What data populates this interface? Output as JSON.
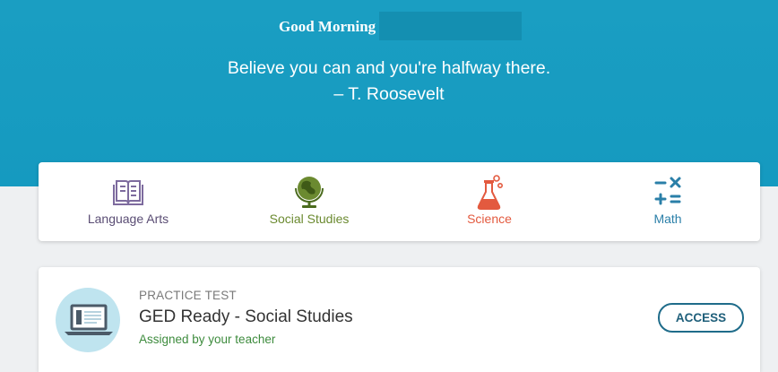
{
  "hero": {
    "greeting": "Good Morning",
    "quote_text": "Believe you can and you're halfway there.",
    "quote_author": "– T. Roosevelt"
  },
  "subjects": [
    {
      "label": "Language Arts",
      "icon": "book-icon",
      "color": "#5a4d74"
    },
    {
      "label": "Social Studies",
      "icon": "globe-icon",
      "color": "#6b8a30"
    },
    {
      "label": "Science",
      "icon": "flask-icon",
      "color": "#e35a3f"
    },
    {
      "label": "Math",
      "icon": "math-symbols-icon",
      "color": "#2a7fa8"
    }
  ],
  "assignment": {
    "kicker": "PRACTICE TEST",
    "title": "GED Ready - Social Studies",
    "assigned_by": "Assigned by your teacher",
    "access_label": "ACCESS",
    "thumb_icon": "laptop-icon"
  },
  "colors": {
    "hero_bg": "#1a9ec2",
    "accent_button": "#1f6c8a"
  }
}
